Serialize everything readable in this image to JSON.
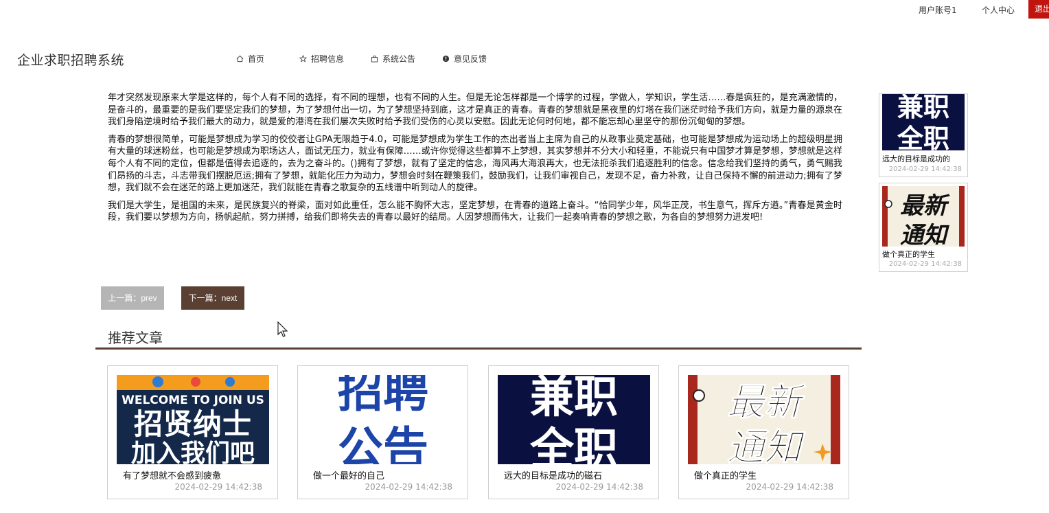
{
  "topbar": {
    "account": "用户账号1",
    "personal_center": "个人中心",
    "logout": "退出"
  },
  "header": {
    "site_title": "企业求职招聘系统",
    "nav": [
      {
        "label": "首页",
        "icon": "home-icon"
      },
      {
        "label": "招聘信息",
        "icon": "star-icon"
      },
      {
        "label": "系统公告",
        "icon": "bag-icon"
      },
      {
        "label": "意见反馈",
        "icon": "alert-circle-icon"
      }
    ]
  },
  "article": {
    "paragraphs": [
      "年才突然发现原来大学是这样的，每个人有不同的选择，有不同的理想，也有不同的人生。但是无论怎样都是一个博学的过程，学做人，学知识，学生活……春是疯狂的，是充满激情的，是奋斗的，最重要的是我们要坚定我们的梦想，为了梦想付出一切，为了梦想坚持到底，这才是真正的青春。青春的梦想就是黑夜里的灯塔在我们迷茫时给予我们方向，就是力量的源泉在我们身陷逆境时给予我们最大的动力，就是爱的港湾在我们屡次失败时给予我们受伤的心灵以安慰。因此无论何时何地，都不能忘却心里坚守的那份沉甸甸的梦想。",
      "青春的梦想很简单，可能是梦想成为学习的佼佼者让GPA无限趋于4.0，可能是梦想成为学生工作的杰出者当上主席为自己的从政事业奠定基础，也可能是梦想成为运动场上的超级明星拥有大量的球迷粉丝，也可能是梦想成为职场达人，面试无压力，就业有保障……或许你觉得这些都算不上梦想，其实梦想并不分大小和轻重，不能说只有中国梦才算是梦想，梦想就是这样每个人有不同的定位，但都是值得去追逐的，去为之奋斗的。()拥有了梦想，就有了坚定的信念，海风再大海浪再大，也无法扼杀我们追逐胜利的信念。信念给我们坚持的勇气，勇气赐我们昂扬的斗志，斗志带我们摆脱厄运;拥有了梦想，就能化压力为动力，梦想会时刻在鞭策我们，鼓励我们，让我们审视自己，发现不足，奋力补救，让自己保持不懈的前进动力;拥有了梦想，我们就不会在迷茫的路上更加迷茫，我们就能在青春之歌复杂的五线谱中听到动人的旋律。",
      "我们是大学生，是祖国的未来，是民族复兴的脊梁，面对如此重任，怎么能不胸怀大志，坚定梦想，在青春的道路上奋斗。“恰同学少年，风华正茂，书生意气，挥斥方遒。”青春是黄金时段，我们要以梦想为方向，扬帆起航，努力拼搏，给我们即将失去的青春以最好的结局。人因梦想而伟大，让我们一起奏响青春的梦想之歌，为各自的梦想努力进发吧!"
    ]
  },
  "pager": {
    "prev": "上一篇：prev",
    "next": "下一篇：next"
  },
  "recommend": {
    "heading": "推荐文章",
    "cards": [
      {
        "title": "有了梦想就不会感到疲惫",
        "date": "2024-02-29 14:42:38",
        "img_en": "WELCOME TO JOIN US",
        "img_line1": "招贤纳士",
        "img_line2": "加入我们吧"
      },
      {
        "title": "做一个最好的自己",
        "date": "2024-02-29 14:42:38",
        "img_line1": "招聘",
        "img_line2": "公告"
      },
      {
        "title": "远大的目标是成功的磁石",
        "date": "2024-02-29 14:42:38",
        "img_line1": "兼职",
        "img_line2": "全职"
      },
      {
        "title": "做个真正的学生",
        "date": "2024-02-29 14:42:38",
        "img_line1": "最新",
        "img_line2": "通知"
      }
    ]
  },
  "sidebar": {
    "items": [
      {
        "title": "远大的目标是成功的",
        "date": "2024-02-29 14:42:38",
        "img_line1": "兼职",
        "img_line2": "全职"
      },
      {
        "title": "做个真正的学生",
        "date": "2024-02-29 14:42:38",
        "img_line1": "最新",
        "img_line2": "通知"
      }
    ]
  },
  "colors": {
    "accent": "#5a4032",
    "logout": "#c0140f",
    "prev_button": "#b5b5b5"
  }
}
